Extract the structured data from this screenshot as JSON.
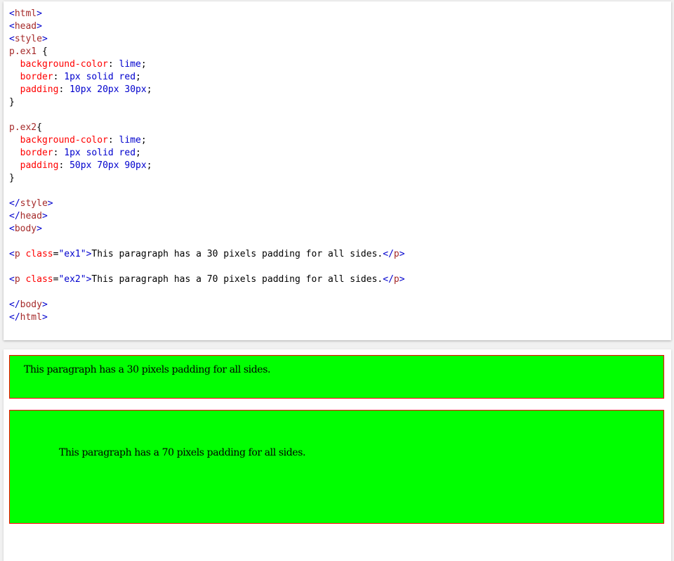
{
  "colors": {
    "lime": "#00ff00",
    "red": "#ff0000",
    "bracket": "#0000cd",
    "tag": "#a52a2a"
  },
  "code": {
    "lines": [
      [
        [
          "br",
          "<"
        ],
        [
          "tag",
          "html"
        ],
        [
          "br",
          ">"
        ]
      ],
      [
        [
          "br",
          "<"
        ],
        [
          "tag",
          "head"
        ],
        [
          "br",
          ">"
        ]
      ],
      [
        [
          "br",
          "<"
        ],
        [
          "tag",
          "style"
        ],
        [
          "br",
          ">"
        ]
      ],
      [
        [
          "sel",
          "p.ex1"
        ],
        [
          "txt",
          " {"
        ]
      ],
      [
        [
          "txt",
          "  "
        ],
        [
          "prop",
          "background-color"
        ],
        [
          "txt",
          ": "
        ],
        [
          "val",
          "lime"
        ],
        [
          "txt",
          ";"
        ]
      ],
      [
        [
          "txt",
          "  "
        ],
        [
          "prop",
          "border"
        ],
        [
          "txt",
          ": "
        ],
        [
          "val",
          "1px solid red"
        ],
        [
          "txt",
          ";"
        ]
      ],
      [
        [
          "txt",
          "  "
        ],
        [
          "prop",
          "padding"
        ],
        [
          "txt",
          ": "
        ],
        [
          "val",
          "10px 20px 30px"
        ],
        [
          "txt",
          ";"
        ]
      ],
      [
        [
          "txt",
          "}"
        ]
      ],
      [],
      [
        [
          "sel",
          "p.ex2"
        ],
        [
          "txt",
          "{"
        ]
      ],
      [
        [
          "txt",
          "  "
        ],
        [
          "prop",
          "background-color"
        ],
        [
          "txt",
          ": "
        ],
        [
          "val",
          "lime"
        ],
        [
          "txt",
          ";"
        ]
      ],
      [
        [
          "txt",
          "  "
        ],
        [
          "prop",
          "border"
        ],
        [
          "txt",
          ": "
        ],
        [
          "val",
          "1px solid red"
        ],
        [
          "txt",
          ";"
        ]
      ],
      [
        [
          "txt",
          "  "
        ],
        [
          "prop",
          "padding"
        ],
        [
          "txt",
          ": "
        ],
        [
          "val",
          "50px 70px 90px"
        ],
        [
          "txt",
          ";"
        ]
      ],
      [
        [
          "txt",
          "}"
        ]
      ],
      [],
      [
        [
          "br",
          "</"
        ],
        [
          "tag",
          "style"
        ],
        [
          "br",
          ">"
        ]
      ],
      [
        [
          "br",
          "</"
        ],
        [
          "tag",
          "head"
        ],
        [
          "br",
          ">"
        ]
      ],
      [
        [
          "br",
          "<"
        ],
        [
          "tag",
          "body"
        ],
        [
          "br",
          ">"
        ]
      ],
      [],
      [
        [
          "br",
          "<"
        ],
        [
          "tag",
          "p"
        ],
        [
          "txt",
          " "
        ],
        [
          "attr",
          "class"
        ],
        [
          "txt",
          "="
        ],
        [
          "str",
          "\"ex1\""
        ],
        [
          "br",
          ">"
        ],
        [
          "txt",
          "This paragraph has a 30 pixels padding for all sides."
        ],
        [
          "br",
          "</"
        ],
        [
          "tag",
          "p"
        ],
        [
          "br",
          ">"
        ]
      ],
      [],
      [
        [
          "br",
          "<"
        ],
        [
          "tag",
          "p"
        ],
        [
          "txt",
          " "
        ],
        [
          "attr",
          "class"
        ],
        [
          "txt",
          "="
        ],
        [
          "str",
          "\"ex2\""
        ],
        [
          "br",
          ">"
        ],
        [
          "txt",
          "This paragraph has a 70 pixels padding for all sides."
        ],
        [
          "br",
          "</"
        ],
        [
          "tag",
          "p"
        ],
        [
          "br",
          ">"
        ]
      ],
      [],
      [
        [
          "br",
          "</"
        ],
        [
          "tag",
          "body"
        ],
        [
          "br",
          ">"
        ]
      ],
      [
        [
          "br",
          "</"
        ],
        [
          "tag",
          "html"
        ],
        [
          "br",
          ">"
        ]
      ]
    ]
  },
  "result": {
    "p1": "This paragraph has a 30 pixels padding for all sides.",
    "p2": "This paragraph has a 70 pixels padding for all sides."
  }
}
